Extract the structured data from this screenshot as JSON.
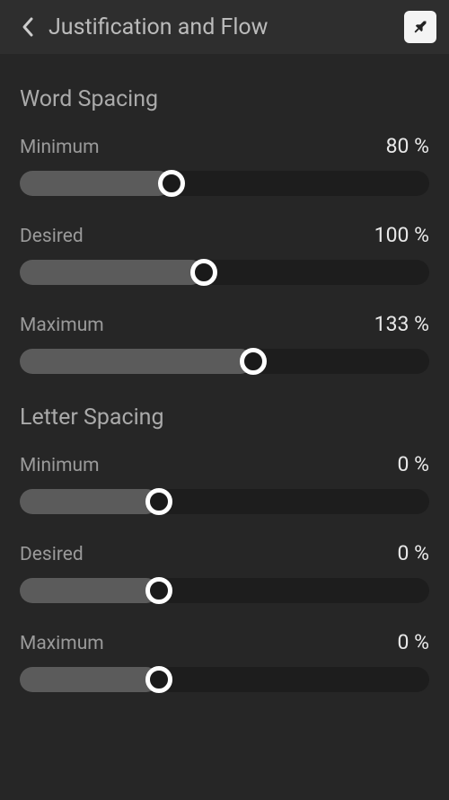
{
  "header": {
    "title": "Justification and Flow"
  },
  "sections": {
    "wordSpacing": {
      "title": "Word Spacing",
      "minimum": {
        "label": "Minimum",
        "value": "80 %",
        "fillPercent": 37
      },
      "desired": {
        "label": "Desired",
        "value": "100 %",
        "fillPercent": 45
      },
      "maximum": {
        "label": "Maximum",
        "value": "133 %",
        "fillPercent": 57
      }
    },
    "letterSpacing": {
      "title": "Letter Spacing",
      "minimum": {
        "label": "Minimum",
        "value": "0 %",
        "fillPercent": 34
      },
      "desired": {
        "label": "Desired",
        "value": "0 %",
        "fillPercent": 34
      },
      "maximum": {
        "label": "Maximum",
        "value": "0 %",
        "fillPercent": 34
      }
    }
  }
}
